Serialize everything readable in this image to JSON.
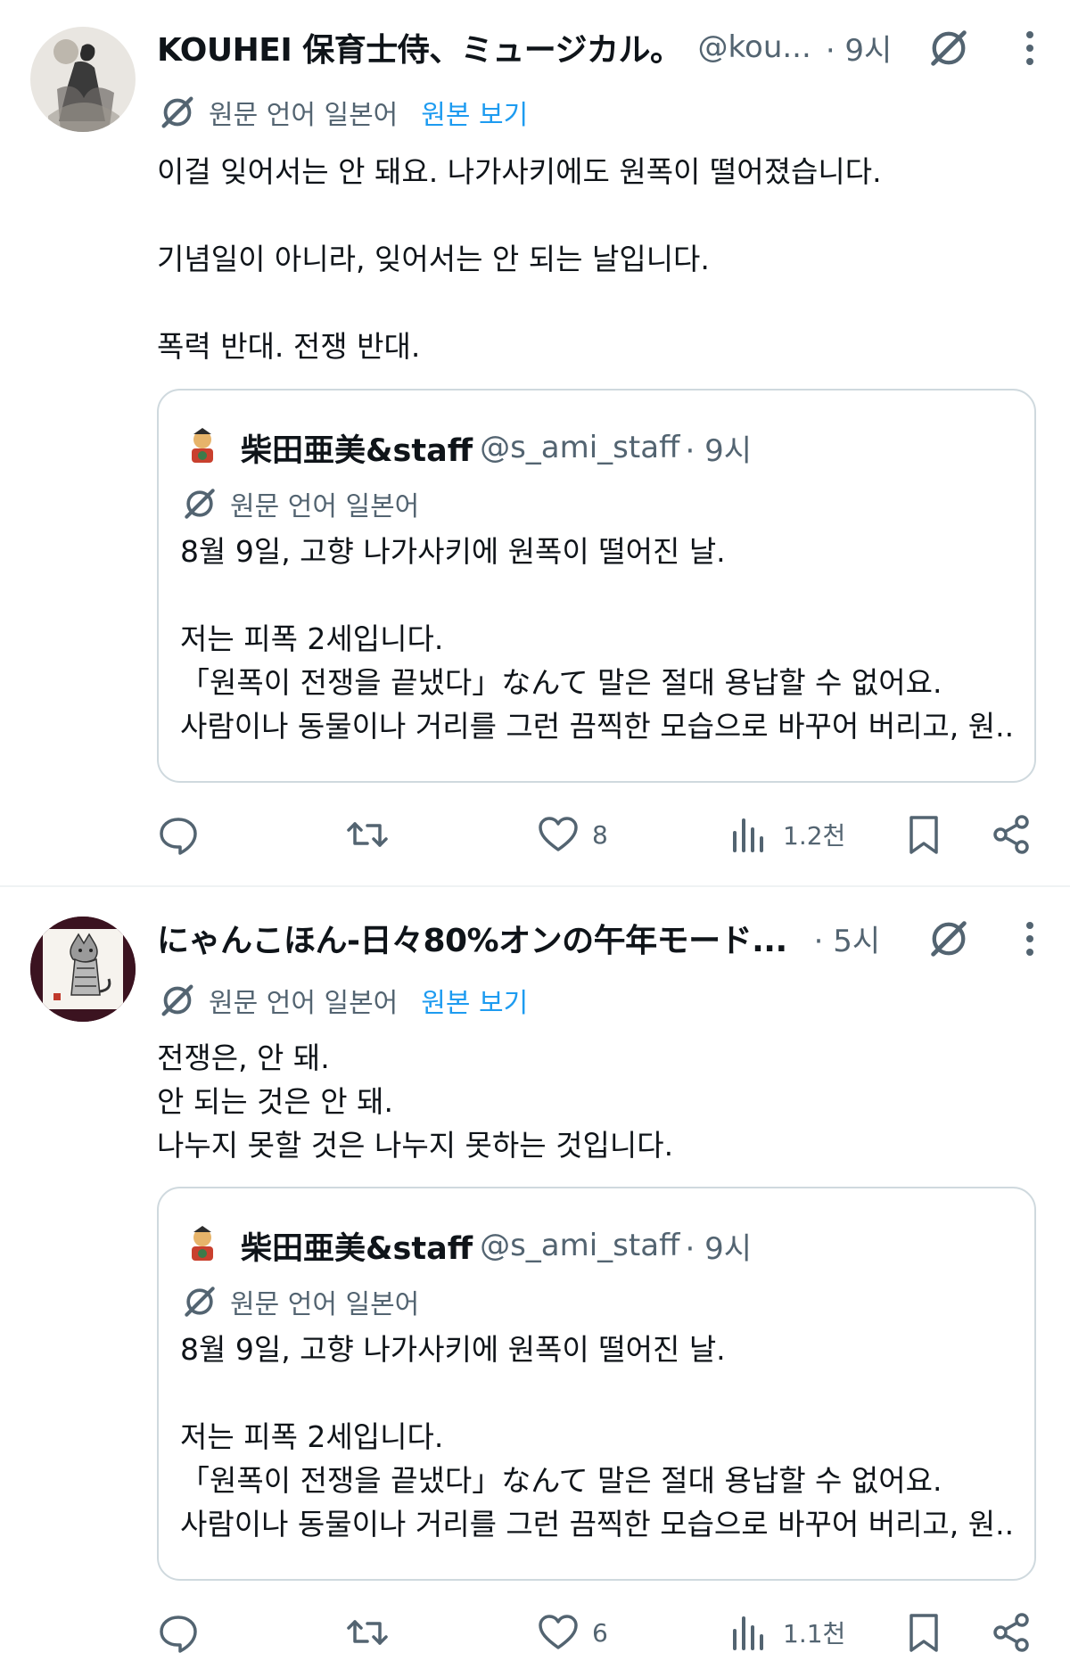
{
  "tweets": [
    {
      "author": {
        "name": "KOUHEI 保育士侍、ミュージカル。",
        "handle": "@kou...",
        "time": "· 9시"
      },
      "translation": {
        "label": "원문 언어 일본어",
        "show_original": "원본 보기"
      },
      "text": [
        "이걸 잊어서는 안 돼요. 나가사키에도 원폭이 떨어졌습니다.",
        "",
        "기념일이 아니라, 잊어서는 안 되는 날입니다.",
        "",
        "폭력 반대. 전쟁 반대."
      ],
      "quote": {
        "name": "柴田亜美&staff",
        "handle": "@s_ami_staff",
        "time": "· 9시",
        "translation_label": "원문 언어 일본어",
        "text": [
          "8월 9일, 고향 나가사키에 원폭이 떨어진 날.",
          "",
          "저는 피폭 2세입니다.",
          "「원폭이 전쟁을 끝냈다」なんて 말은 절대 용납할 수 없어요.",
          "사람이나 동물이나 거리를 그런 끔찍한 모습으로 바꾸어 버리고, 원..."
        ]
      },
      "actions": {
        "replies": "",
        "reposts": "",
        "likes": "8",
        "views": "1.2천"
      }
    },
    {
      "author": {
        "name": "にゃんこほん-日々80%オンの午年モード...",
        "handle": "",
        "time": "· 5시"
      },
      "translation": {
        "label": "원문 언어 일본어",
        "show_original": "원본 보기"
      },
      "text": [
        "전쟁은, 안 돼.",
        "안 되는 것은 안 돼.",
        "나누지 못할 것은 나누지 못하는 것입니다."
      ],
      "quote": {
        "name": "柴田亜美&staff",
        "handle": "@s_ami_staff",
        "time": "· 9시",
        "translation_label": "원문 언어 일본어",
        "text": [
          "8월 9일, 고향 나가사키에 원폭이 떨어진 날.",
          "",
          "저는 피폭 2세입니다.",
          "「원폭이 전쟁을 끝냈다」なんて 말은 절대 용납할 수 없어요.",
          "사람이나 동물이나 거리를 그런 끔찍한 모습으로 바꾸어 버리고, 원..."
        ]
      },
      "actions": {
        "replies": "",
        "reposts": "",
        "likes": "6",
        "views": "1.1천"
      }
    }
  ],
  "icons": {
    "grok": "grok-icon",
    "more": "more-dots-icon",
    "translate": "translate-icon",
    "reply": "reply-icon",
    "repost": "repost-icon",
    "like": "heart-icon",
    "views": "views-chart-icon",
    "bookmark": "bookmark-icon",
    "share": "share-icon"
  },
  "colors": {
    "text": "#0f1419",
    "secondary": "#536471",
    "link": "#1d9bf0",
    "border": "#cfd9de"
  }
}
